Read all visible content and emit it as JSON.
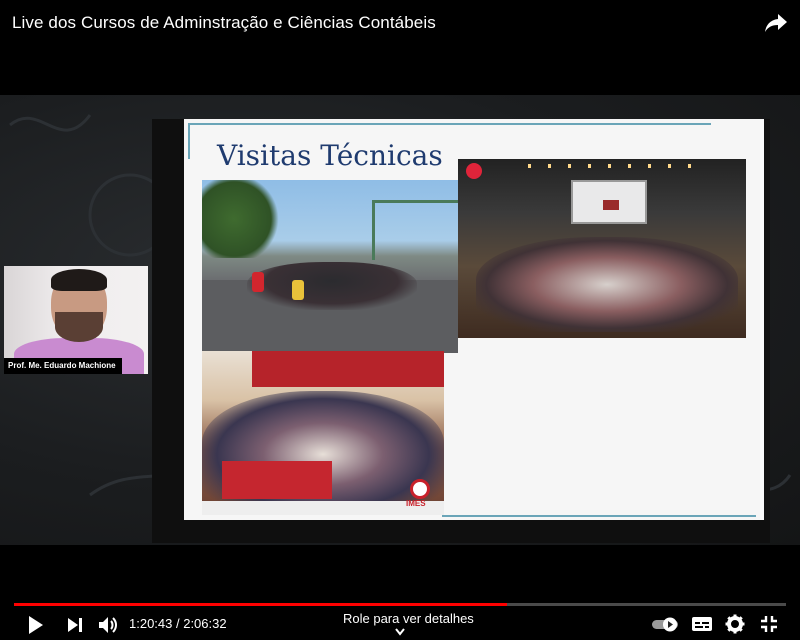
{
  "video": {
    "title": "Live dos Cursos de Adminstração e Ciências Contábeis",
    "presenter_name": "Prof. Me. Eduardo Machione",
    "current_time": "1:20:43",
    "duration": "2:06:32",
    "time_display": "1:20:43 / 2:06:32",
    "progress_fraction": 0.638,
    "details_hint": "Role para ver detalhes"
  },
  "slide": {
    "title": "Visitas Técnicas",
    "logo_text": "IMES"
  },
  "icons": {
    "share": "share-arrow-icon",
    "play": "play-icon",
    "next": "skip-next-icon",
    "volume": "volume-icon",
    "autoplay": "autoplay-toggle-icon",
    "captions": "subtitles-icon",
    "settings": "gear-icon",
    "exit_fullscreen": "exit-fullscreen-icon",
    "chevron": "chevron-down-icon"
  },
  "colors": {
    "progress": "#ff0000",
    "slide_title": "#1f3b6f",
    "slide_accent": "#6aa5b8"
  }
}
